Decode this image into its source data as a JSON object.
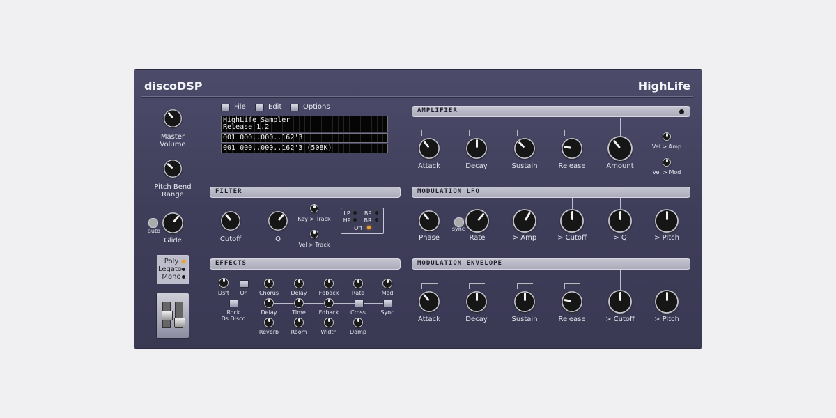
{
  "header": {
    "brand": "discoDSP",
    "product": "HighLife"
  },
  "menu": {
    "file": "File",
    "edit": "Edit",
    "options": "Options"
  },
  "display": {
    "line1": "HighLife Sampler",
    "line2": "Release 1.2",
    "line3": "001 000..000..162'3",
    "line4": "001 000..000..162'3 (508K)"
  },
  "global": {
    "master_volume": "Master Volume",
    "pitch_bend": "Pitch Bend Range",
    "auto": "auto",
    "glide": "Glide",
    "modes": [
      "Poly",
      "Legato",
      "Mono"
    ],
    "selected_mode": "Poly"
  },
  "filter": {
    "title": "FILTER",
    "cutoff": "Cutoff",
    "q": "Q",
    "key_track": "Key > Track",
    "vel_track": "Vel > Track",
    "types": [
      "LP",
      "BP",
      "HP",
      "BR",
      "Off"
    ],
    "selected": "Off"
  },
  "effects": {
    "title": "EFFECTS",
    "dsft": "Dsft",
    "on": "On",
    "rock": "Rock",
    "disco": "Ds Disco",
    "chorus": [
      "Chorus",
      "Delay",
      "Fdback",
      "Rate",
      "Mod"
    ],
    "delay": [
      "Delay",
      "Time",
      "Fdback",
      "Cross",
      "Sync"
    ],
    "reverb": [
      "Reverb",
      "Room",
      "Width",
      "Damp"
    ]
  },
  "amplifier": {
    "title": "AMPLIFIER",
    "knobs": [
      "Attack",
      "Decay",
      "Sustain",
      "Release",
      "Amount"
    ],
    "vel_amp": "Vel > Amp",
    "vel_mod": "Vel > Mod"
  },
  "lfo": {
    "title": "MODULATION LFO",
    "sync": "sync",
    "knobs": [
      "Phase",
      "Rate",
      "> Amp",
      "> Cutoff",
      "> Q",
      "> Pitch"
    ]
  },
  "envelope": {
    "title": "MODULATION ENVELOPE",
    "knobs": [
      "Attack",
      "Decay",
      "Sustain",
      "Release",
      "> Cutoff",
      "> Pitch"
    ]
  },
  "colors": {
    "panel": "#434260",
    "led_on": "#f0a028",
    "bar": "#b8b8c6"
  }
}
